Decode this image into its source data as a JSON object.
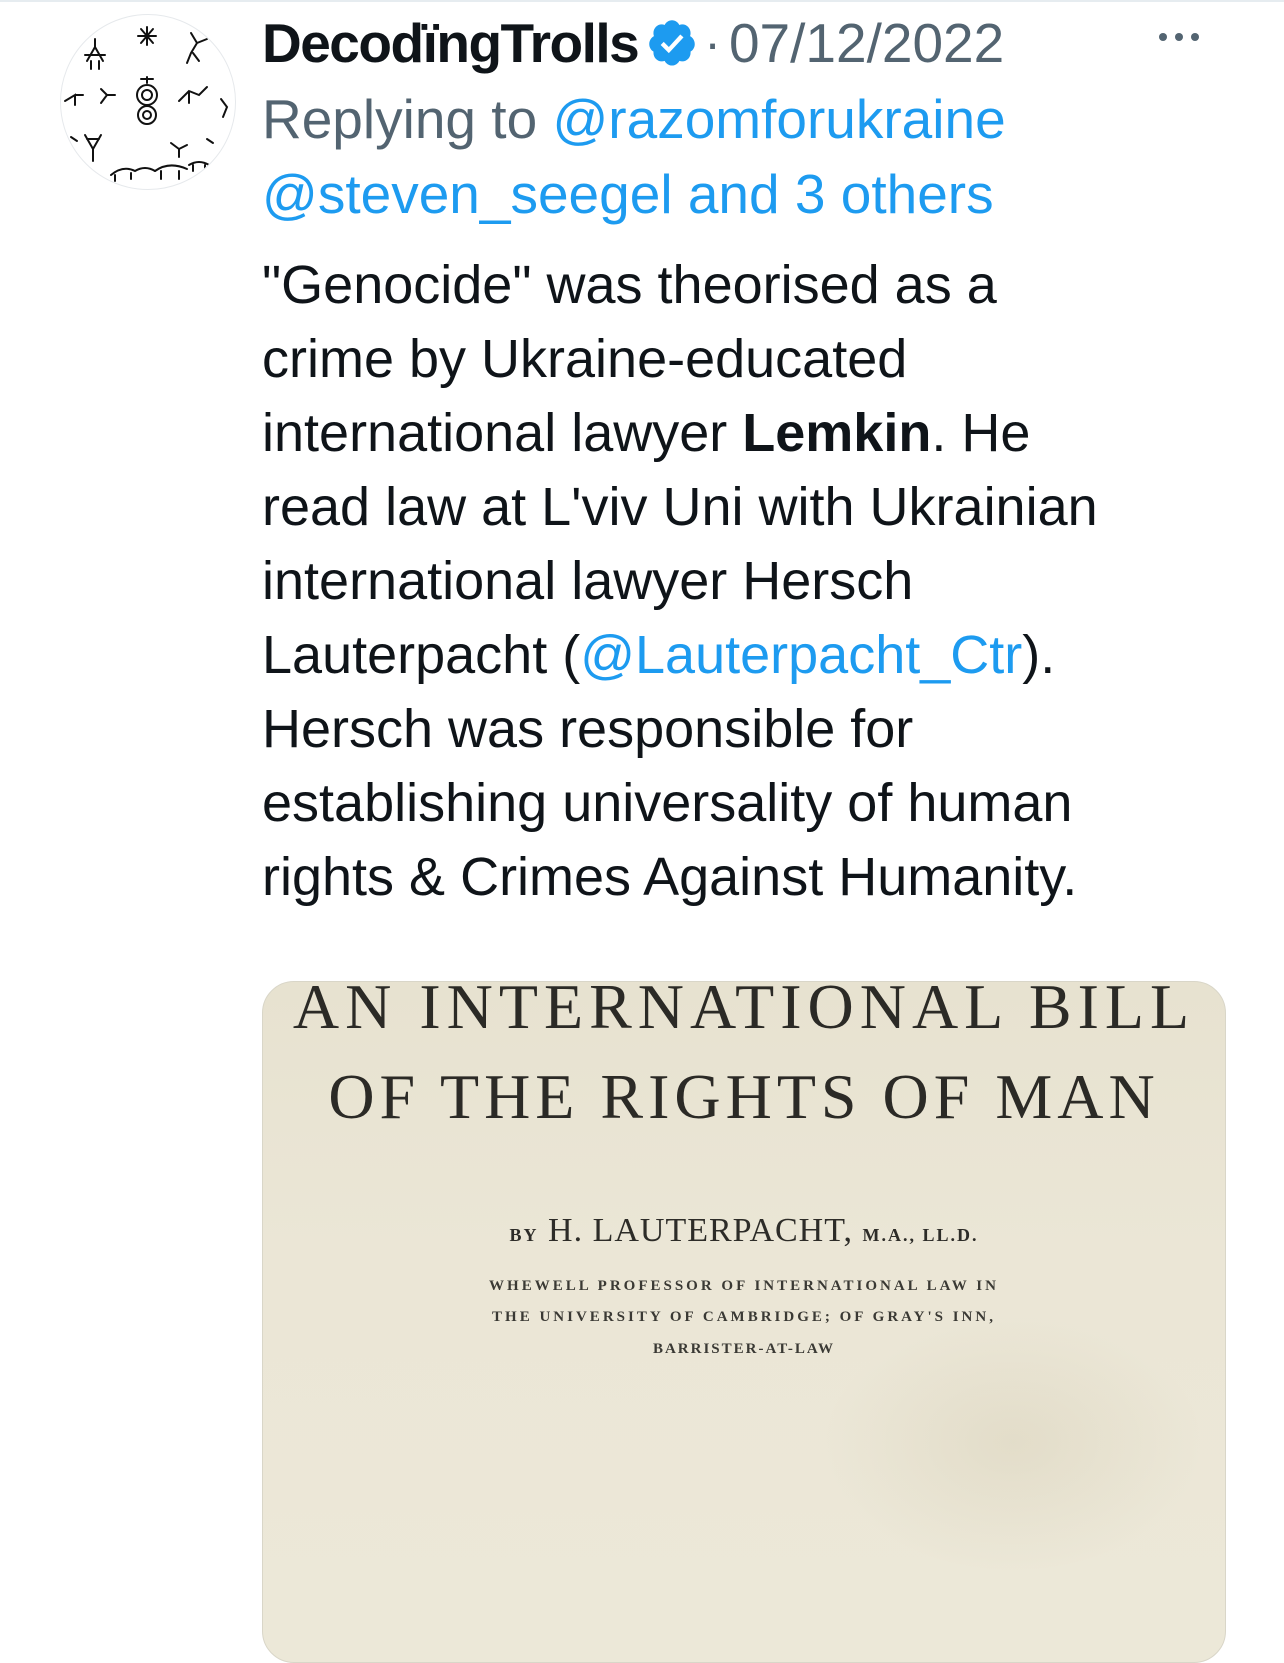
{
  "tweet": {
    "display_name": "DecodïngTrolls",
    "separator": "·",
    "date": "07/12/2022",
    "replying_to_label": "Replying to",
    "mentions": [
      "@razomforukraine",
      "@steven_seegel",
      "and 3 others"
    ],
    "body": {
      "line1": "\"Genocide\" was theorised as a",
      "line2": "crime by Ukraine-educated",
      "line3_pre": "international lawyer ",
      "line3_bold": "Lemkin",
      "line3_post": ". He",
      "line4": "read law at L'viv Uni with Ukrainian",
      "line5": "international lawyer Hersch",
      "line6_pre": "Lauterpacht (",
      "line6_mention": "@Lauterpacht_Ctr",
      "line6_post": ").",
      "line7": "Hersch was responsible for",
      "line8": "establishing universality of human",
      "line9": "rights & Crimes Against Humanity."
    },
    "media": {
      "title_line1": "AN INTERNATIONAL BILL",
      "title_line2": "OF THE RIGHTS OF MAN",
      "by": "BY",
      "author": "H. LAUTERPACHT,",
      "degrees": "M.A., LL.D.",
      "sub_line1": "WHEWELL PROFESSOR OF INTERNATIONAL LAW IN",
      "sub_line2": "THE UNIVERSITY OF CAMBRIDGE; OF GRAY'S INN,",
      "sub_line3": "BARRISTER-AT-LAW"
    }
  },
  "icons": {
    "avatar": "petroglyph-avatar-icon",
    "verified": "verified-badge-icon",
    "more": "more-options-icon"
  },
  "colors": {
    "text": "#0f1419",
    "secondary": "#536471",
    "link": "#1d9bf0",
    "paper": "#e9e4d3"
  }
}
